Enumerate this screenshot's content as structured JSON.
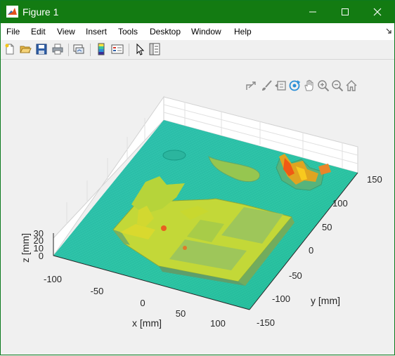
{
  "window": {
    "title": "Figure 1"
  },
  "menu": [
    "File",
    "Edit",
    "View",
    "Insert",
    "Tools",
    "Desktop",
    "Window",
    "Help"
  ],
  "toolbar": {
    "buttons": [
      "new-figure-icon",
      "open-file-icon",
      "save-icon",
      "print-icon",
      "link-plot-icon",
      "colorbar-icon",
      "legend-icon",
      "edit-plot-icon",
      "property-inspector-icon"
    ]
  },
  "axes_toolbar": [
    "export-icon",
    "brush-icon",
    "data-tips-icon",
    "rotate-3d-icon",
    "pan-icon",
    "zoom-in-icon",
    "zoom-out-icon",
    "restore-view-icon"
  ],
  "chart_data": {
    "type": "surface",
    "xlabel": "x [mm]",
    "ylabel": "y [mm]",
    "zlabel": "z [mm]",
    "x_ticks": [
      "-100",
      "-50",
      "0",
      "50",
      "100"
    ],
    "y_ticks": [
      "-150",
      "-100",
      "-50",
      "0",
      "50",
      "100",
      "150"
    ],
    "z_ticks": [
      "0",
      "10",
      "20",
      "30"
    ],
    "xlim": [
      -125,
      125
    ],
    "ylim": [
      -160,
      160
    ],
    "zlim": [
      0,
      30
    ],
    "grid": true,
    "colormap": "parula"
  }
}
